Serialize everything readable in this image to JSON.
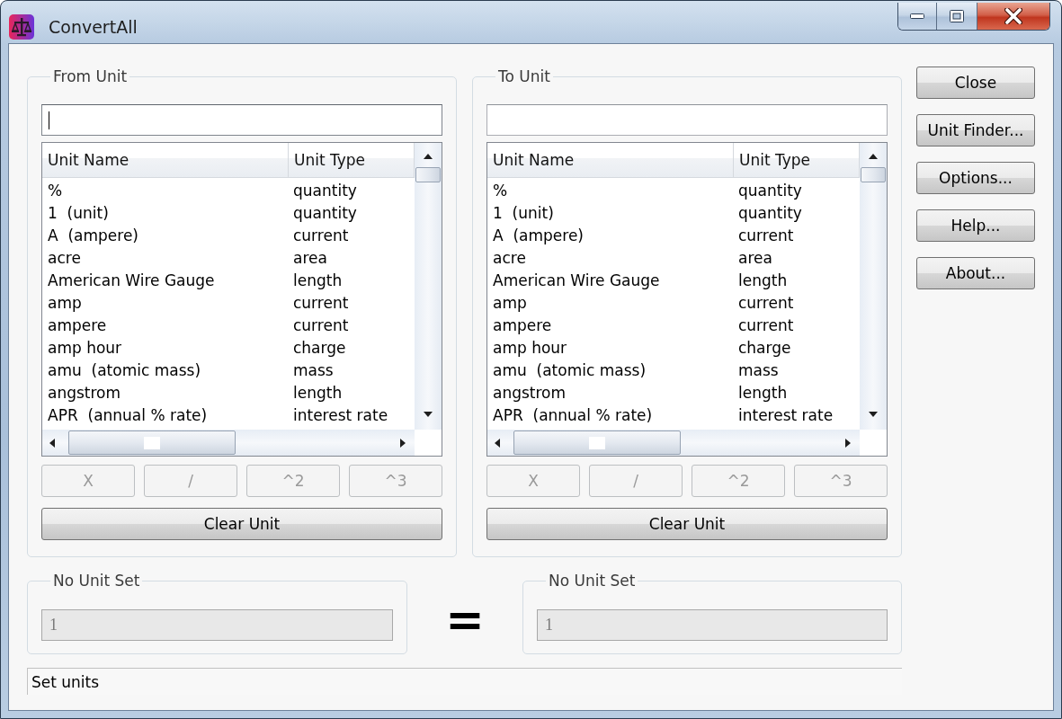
{
  "window": {
    "title": "ConvertAll"
  },
  "unit_panels": [
    {
      "title": "From Unit",
      "search": {
        "focused": true
      },
      "columns": [
        "Unit Name",
        "Unit Type"
      ],
      "rows": [
        {
          "name": "%",
          "type": "quantity"
        },
        {
          "name": "1  (unit)",
          "type": "quantity"
        },
        {
          "name": "A  (ampere)",
          "type": "current"
        },
        {
          "name": "acre",
          "type": "area"
        },
        {
          "name": "American Wire Gauge",
          "type": "length"
        },
        {
          "name": "amp",
          "type": "current"
        },
        {
          "name": "ampere",
          "type": "current"
        },
        {
          "name": "amp hour",
          "type": "charge"
        },
        {
          "name": "amu  (atomic mass)",
          "type": "mass"
        },
        {
          "name": "angstrom",
          "type": "length"
        },
        {
          "name": "APR  (annual % rate)",
          "type": "interest rate"
        }
      ],
      "operators": [
        {
          "label": "X",
          "disabled": true
        },
        {
          "label": "/",
          "disabled": true
        },
        {
          "label": "^2",
          "disabled": true
        },
        {
          "label": "^3",
          "disabled": true
        }
      ],
      "clear_button": {
        "label": "Clear Unit"
      }
    },
    {
      "title": "To Unit",
      "search": {
        "focused": false
      },
      "columns": [
        "Unit Name",
        "Unit Type"
      ],
      "rows": [
        {
          "name": "%",
          "type": "quantity"
        },
        {
          "name": "1  (unit)",
          "type": "quantity"
        },
        {
          "name": "A  (ampere)",
          "type": "current"
        },
        {
          "name": "acre",
          "type": "area"
        },
        {
          "name": "American Wire Gauge",
          "type": "length"
        },
        {
          "name": "amp",
          "type": "current"
        },
        {
          "name": "ampere",
          "type": "current"
        },
        {
          "name": "amp hour",
          "type": "charge"
        },
        {
          "name": "amu  (atomic mass)",
          "type": "mass"
        },
        {
          "name": "angstrom",
          "type": "length"
        },
        {
          "name": "APR  (annual % rate)",
          "type": "interest rate"
        }
      ],
      "operators": [
        {
          "label": "X",
          "disabled": true
        },
        {
          "label": "/",
          "disabled": true
        },
        {
          "label": "^2",
          "disabled": true
        },
        {
          "label": "^3",
          "disabled": true
        }
      ],
      "clear_button": {
        "label": "Clear Unit"
      }
    }
  ],
  "side_buttons": [
    {
      "label": "Close"
    },
    {
      "label": "Unit Finder..."
    },
    {
      "label": "Options..."
    },
    {
      "label": "Help..."
    },
    {
      "label": "About..."
    }
  ],
  "value_panels": [
    {
      "title": "No Unit Set",
      "value": "1",
      "disabled": true
    },
    {
      "title": "No Unit Set",
      "value": "1",
      "disabled": true
    }
  ],
  "equals_sign": "=",
  "status_bar": {
    "text": "Set units"
  }
}
